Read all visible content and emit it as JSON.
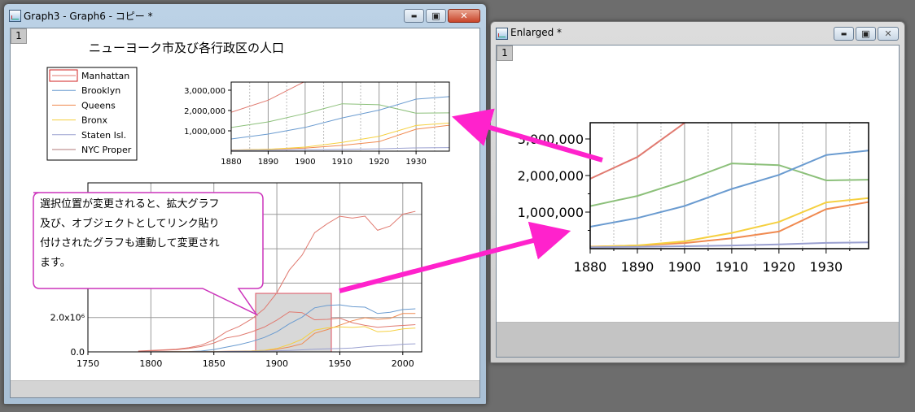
{
  "window1": {
    "title": "Graph3 - Graph6 - コピー *",
    "page_num": "1"
  },
  "window2": {
    "title": "Enlarged *",
    "page_num": "1"
  },
  "window_controls": {
    "minimize": "▬",
    "maximize": "▣",
    "close": "✕"
  },
  "graph1": {
    "title": "ニューヨーク市及び各行政区の人口",
    "legend": [
      "Manhattan",
      "Brooklyn",
      "Queens",
      "Bronx",
      "Staten Isl.",
      "NYC Proper"
    ],
    "callout": [
      "選択位置が変更されると、拡大グラフ",
      "及び、オブジェクトとしてリンク貼り",
      "付けされたグラフも連動して変更され",
      "ます。"
    ]
  },
  "colors": {
    "Manhattan": "#e07a70",
    "Brooklyn": "#6a9bd0",
    "Queens": "#f08a50",
    "Bronx": "#f5d040",
    "Staten Isl.": "#9aa0d0",
    "NYC Proper": "#b07878",
    "green": "#8cc07a",
    "arrow": "#ff22cc",
    "callout_border": "#cc33bb"
  },
  "chart_data": [
    {
      "type": "line",
      "x": [
        1790,
        1800,
        1810,
        1820,
        1830,
        1840,
        1850,
        1860,
        1870,
        1880,
        1890,
        1900,
        1910,
        1920,
        1930,
        1940,
        1950,
        1960,
        1970,
        1980,
        1990,
        2000,
        2010
      ],
      "series": [
        {
          "name": "Manhattan",
          "values": [
            33131,
            60515,
            96373,
            123706,
            202589,
            312710,
            515547,
            813669,
            942292,
            1164673,
            1441216,
            1850093,
            2331542,
            2284103,
            1867312,
            1889924,
            1960101,
            1698281,
            1539233,
            1428285,
            1487536,
            1537195,
            1585873
          ]
        },
        {
          "name": "Brooklyn",
          "values": [
            4549,
            5740,
            8303,
            11187,
            20535,
            47613,
            138882,
            279122,
            419921,
            599495,
            838547,
            1166582,
            1634351,
            2018356,
            2560401,
            2698285,
            2738175,
            2627319,
            2602012,
            2230936,
            2300664,
            2465326,
            2504700
          ]
        },
        {
          "name": "Queens",
          "values": [
            6159,
            6642,
            7444,
            8246,
            9049,
            14480,
            18593,
            32903,
            45468,
            56559,
            87050,
            152999,
            284041,
            469042,
            1079129,
            1297634,
            1550849,
            1809578,
            1986473,
            1891325,
            1951598,
            2229379,
            2230722
          ]
        },
        {
          "name": "Bronx",
          "values": [
            1781,
            1755,
            2267,
            2782,
            3023,
            5346,
            8032,
            23593,
            37393,
            51980,
            88908,
            200507,
            430980,
            732016,
            1265258,
            1394711,
            1451277,
            1424815,
            1471701,
            1168972,
            1203789,
            1332650,
            1385108
          ]
        },
        {
          "name": "Staten Isl.",
          "values": [
            3827,
            4564,
            5347,
            6135,
            7082,
            10965,
            15061,
            25492,
            33029,
            38991,
            51693,
            67021,
            85969,
            116531,
            158346,
            174441,
            191555,
            221991,
            295443,
            352121,
            378977,
            443728,
            468730
          ]
        },
        {
          "name": "NYC Proper",
          "values": [
            49447,
            79216,
            119734,
            152056,
            242278,
            391114,
            696115,
            1174779,
            1478103,
            1911698,
            2507414,
            3437202,
            4766883,
            5620048,
            6930446,
            7454995,
            7891957,
            7781984,
            7894862,
            7071639,
            7322564,
            8008278,
            8175133
          ]
        }
      ],
      "title": "ニューヨーク市及び各行政区の人口",
      "xlim": [
        1750,
        2015
      ],
      "xticks": [
        "1750",
        "1800",
        "1850",
        "1900",
        "1950",
        "2000"
      ],
      "yticks": [
        "0.0",
        "2.0x10⁶"
      ]
    },
    {
      "type": "line",
      "x": [
        1880,
        1890,
        1900,
        1910,
        1920,
        1930,
        1940
      ],
      "series_colors": [
        "Manhattan",
        "Brooklyn",
        "Queens",
        "Bronx",
        "Staten Isl."
      ],
      "xlim": [
        1880,
        1940
      ],
      "ylim": [
        0,
        3000000
      ],
      "xticks": [
        "1880",
        "1890",
        "1900",
        "1910",
        "1920",
        "1930"
      ],
      "yticks": [
        "1,000,000",
        "2,000,000",
        "3,000,000"
      ]
    }
  ]
}
